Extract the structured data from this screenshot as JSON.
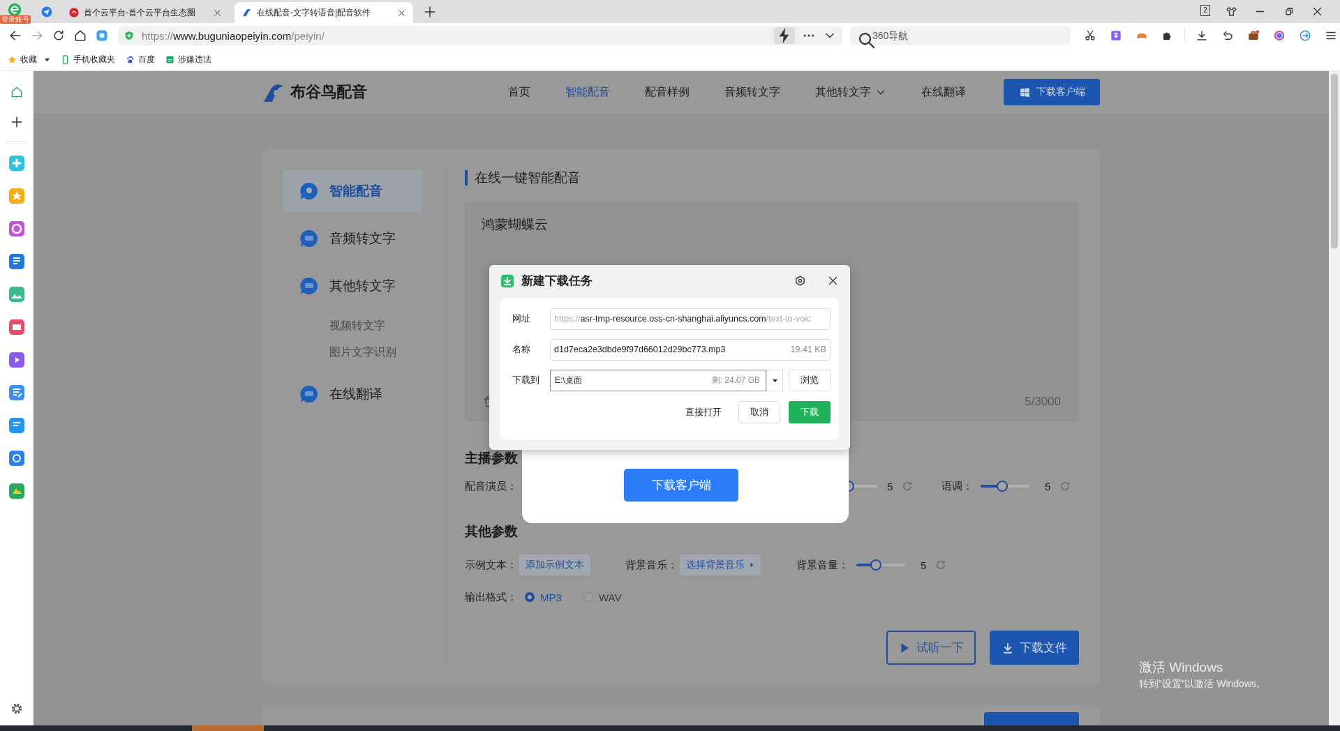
{
  "browser": {
    "login_badge": "登录账号",
    "tabs": [
      {
        "title": "首个云平台-首个云平台生态圈",
        "selected": false
      },
      {
        "title": "在线配音-文字转语音|配音软件",
        "selected": true
      }
    ],
    "tab_count": "2",
    "address": {
      "scheme": "https://",
      "host": "www.buguniaopeiyin.com",
      "path": "/peiyin/"
    },
    "search": {
      "placeholder": "360导航"
    },
    "bookmarks": [
      {
        "label": "收藏",
        "kind": "star"
      },
      {
        "label": "手机收藏夹",
        "kind": "phone"
      },
      {
        "label": "百度",
        "kind": "paw"
      },
      {
        "label": "涉嫌违法",
        "kind": "sheet"
      }
    ]
  },
  "site": {
    "logo": "布谷鸟配音",
    "nav": [
      {
        "label": "首页",
        "selected": false,
        "has_menu": false
      },
      {
        "label": "智能配音",
        "selected": true,
        "has_menu": false
      },
      {
        "label": "配音样例",
        "selected": false,
        "has_menu": false
      },
      {
        "label": "音频转文字",
        "selected": false,
        "has_menu": false
      },
      {
        "label": "其他转文字",
        "selected": false,
        "has_menu": true
      },
      {
        "label": "在线翻译",
        "selected": false,
        "has_menu": false
      }
    ],
    "header_button": "下载客户端",
    "side_menu": [
      {
        "label": "智能配音",
        "selected": true
      },
      {
        "label": "音频转文字",
        "selected": false
      },
      {
        "label": "其他转文字",
        "selected": false,
        "children": [
          {
            "label": "视频转文字",
            "selected": false
          },
          {
            "label": "图片文字识别",
            "selected": false
          }
        ]
      },
      {
        "label": "在线翻译",
        "selected": false
      }
    ],
    "section_title": "在线一键智能配音",
    "editor": {
      "value": "鸿蒙蝴蝶云",
      "counter": "5/3000"
    },
    "anchor_params": {
      "title": "主播参数",
      "voice_label": "配音演员：",
      "speed": {
        "reading": "5"
      },
      "pitch": {
        "label": "语调：",
        "level": 0.45,
        "reading": "5"
      }
    },
    "other_params": {
      "title": "其他参数",
      "sample_label": "示例文本：",
      "sample_button": "添加示例文本",
      "music_label": "背景音乐：",
      "music_button": "选择背景音乐",
      "volume": {
        "label": "背景音量：",
        "level": 0.42,
        "reading": "5"
      },
      "format_label": "输出格式：",
      "formats": [
        {
          "label": "MP3",
          "selected": true
        },
        {
          "label": "WAV",
          "selected": false
        }
      ]
    },
    "actions": [
      {
        "label": "试听一下",
        "kind": "outline"
      },
      {
        "label": "下载文件",
        "kind": "filled"
      }
    ],
    "client_modal": {
      "button": "下载客户端"
    }
  },
  "download_dialog": {
    "title": "新建下载任务",
    "url_label": "网址",
    "url": {
      "scheme": "https://",
      "host": "asr-tmp-resource.oss-cn-shanghai.aliyuncs.com",
      "path": "/text-to-voic"
    },
    "name_label": "名称",
    "file_name": "d1d7eca2e3dbde9f97d66012d29bc773.mp3",
    "file_size": "19.41 KB",
    "dest_label": "下载到",
    "dest": "E:\\桌面",
    "free_space": "剩: 24.07 GB",
    "browse": "浏览",
    "buttons": [
      {
        "label": "直接打开",
        "kind": "link"
      },
      {
        "label": "取消",
        "kind": "default"
      },
      {
        "label": "下载",
        "kind": "primary"
      }
    ]
  },
  "os_watermark": [
    "激活 Windows",
    "转到“设置”以激活 Windows。"
  ]
}
